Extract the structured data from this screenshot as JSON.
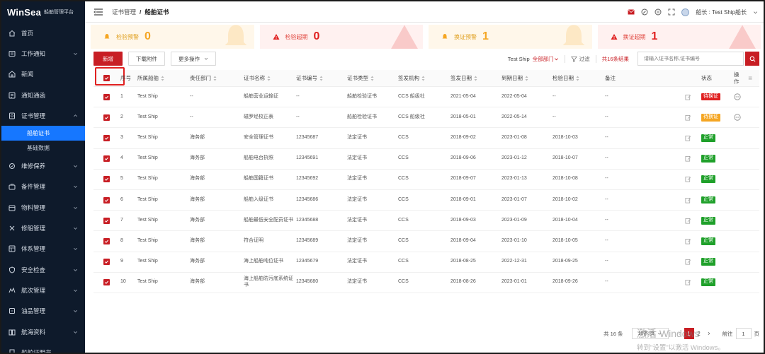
{
  "app": {
    "brand": "WinSea",
    "subtitle": "船舶管理平台"
  },
  "sidebar": {
    "items": [
      {
        "label": "首页",
        "icon": "home-icon"
      },
      {
        "label": "工作通知",
        "icon": "notice-icon"
      },
      {
        "label": "新闻",
        "icon": "news-icon"
      },
      {
        "label": "通知通函",
        "icon": "bulletin-icon"
      },
      {
        "label": "证书管理",
        "icon": "certificate-icon",
        "expanded": true
      }
    ],
    "sub_items": [
      {
        "label": "船舶证书",
        "active": true
      },
      {
        "label": "基础数据",
        "active": false
      }
    ],
    "items_after": [
      {
        "label": "维修保养"
      },
      {
        "label": "备件管理"
      },
      {
        "label": "物料管理"
      },
      {
        "label": "修船管理"
      },
      {
        "label": "体系管理"
      },
      {
        "label": "安全检查"
      },
      {
        "label": "航次管理"
      },
      {
        "label": "油品管理"
      },
      {
        "label": "航海资料"
      },
      {
        "label": "船舶证明书"
      }
    ]
  },
  "header": {
    "breadcrumb_parent": "证书管理",
    "breadcrumb_sep": "/",
    "breadcrumb_current": "船舶证书",
    "user": "船长 : Test Ship船长"
  },
  "stats": [
    {
      "label": "检验预警",
      "value": "0",
      "kind": "warn"
    },
    {
      "label": "检验超期",
      "value": "0",
      "kind": "alert"
    },
    {
      "label": "换证预警",
      "value": "1",
      "kind": "warn"
    },
    {
      "label": "换证超期",
      "value": "1",
      "kind": "alert"
    }
  ],
  "toolbar": {
    "add": "新增",
    "download": "下载附件",
    "more": "更多操作",
    "ship": "Test Ship",
    "dept": "全部部门",
    "filter": "过滤",
    "count": "共16条结果",
    "search_placeholder": "请输入证书名称,证书编号"
  },
  "table": {
    "headers": {
      "no": "序号",
      "ship": "所属船舶",
      "dept": "责任部门",
      "name": "证书名称",
      "code": "证书编号",
      "type": "证书类型",
      "org": "签发机构",
      "issue": "签发日期",
      "expire": "到期日期",
      "check": "检验日期",
      "note": "备注",
      "status": "状态",
      "op": "操作"
    },
    "rows": [
      {
        "no": "1",
        "ship": "Test Ship",
        "dept": "--",
        "name": "船舶营业运输证",
        "code": "--",
        "type": "船舶检验证书",
        "org": "CCS 船级社",
        "issue": "2021-05-04",
        "expire": "2022-05-04",
        "check": "--",
        "note": "--",
        "status": "待换证",
        "status_color": "red",
        "has_more": true
      },
      {
        "no": "2",
        "ship": "Test Ship",
        "dept": "--",
        "name": "磁罗经校正表",
        "code": "--",
        "type": "船舶检验证书",
        "org": "CCS 船级社",
        "issue": "2018-05-01",
        "expire": "2022-05-14",
        "check": "--",
        "note": "--",
        "status": "待换证",
        "status_color": "orange",
        "has_more": true
      },
      {
        "no": "3",
        "ship": "Test Ship",
        "dept": "海务部",
        "name": "安全管理证书",
        "code": "12345687",
        "type": "法定证书",
        "org": "CCS",
        "issue": "2018-09-02",
        "expire": "2023-01-08",
        "check": "2018-10-03",
        "note": "--",
        "status": "正常",
        "status_color": "green",
        "has_more": false
      },
      {
        "no": "4",
        "ship": "Test Ship",
        "dept": "海务部",
        "name": "船舶电台执照",
        "code": "12345691",
        "type": "法定证书",
        "org": "CCS",
        "issue": "2018-09-06",
        "expire": "2023-01-12",
        "check": "2018-10-07",
        "note": "--",
        "status": "正常",
        "status_color": "green",
        "has_more": false
      },
      {
        "no": "5",
        "ship": "Test Ship",
        "dept": "海务部",
        "name": "船舶国籍证书",
        "code": "12345692",
        "type": "法定证书",
        "org": "CCS",
        "issue": "2018-09-07",
        "expire": "2023-01-13",
        "check": "2018-10-08",
        "note": "--",
        "status": "正常",
        "status_color": "green",
        "has_more": false
      },
      {
        "no": "6",
        "ship": "Test Ship",
        "dept": "海务部",
        "name": "船舶入级证书",
        "code": "12345686",
        "type": "法定证书",
        "org": "CCS",
        "issue": "2018-09-01",
        "expire": "2023-01-07",
        "check": "2018-10-02",
        "note": "--",
        "status": "正常",
        "status_color": "green",
        "has_more": false
      },
      {
        "no": "7",
        "ship": "Test Ship",
        "dept": "海务部",
        "name": "船舶最低安全配员证书",
        "code": "12345688",
        "type": "法定证书",
        "org": "CCS",
        "issue": "2018-09-03",
        "expire": "2023-01-09",
        "check": "2018-10-04",
        "note": "--",
        "status": "正常",
        "status_color": "green",
        "has_more": false
      },
      {
        "no": "8",
        "ship": "Test Ship",
        "dept": "海务部",
        "name": "符合证明",
        "code": "12345689",
        "type": "法定证书",
        "org": "CCS",
        "issue": "2018-09-04",
        "expire": "2023-01-10",
        "check": "2018-10-05",
        "note": "--",
        "status": "正常",
        "status_color": "green",
        "has_more": false
      },
      {
        "no": "9",
        "ship": "Test Ship",
        "dept": "海务部",
        "name": "海上船舶吨位证书",
        "code": "12345679",
        "type": "法定证书",
        "org": "CCS",
        "issue": "2018-08-25",
        "expire": "2022-12-31",
        "check": "2018-09-25",
        "note": "--",
        "status": "正常",
        "status_color": "green",
        "has_more": false
      },
      {
        "no": "10",
        "ship": "Test Ship",
        "dept": "海务部",
        "name": "海上船舶防污底系统证书",
        "code": "12345680",
        "type": "法定证书",
        "org": "CCS",
        "issue": "2018-08-26",
        "expire": "2023-01-01",
        "check": "2018-09-26",
        "note": "--",
        "status": "正常",
        "status_color": "green",
        "has_more": false
      }
    ]
  },
  "pagination": {
    "total": "共 16 条",
    "page_size": "10条/页",
    "current_page": "1",
    "next_page": "2",
    "goto_label": "前往",
    "goto_value": "1",
    "page_unit": "页"
  },
  "watermark": {
    "line1": "激活 Windows",
    "line2": "转到\"设置\"以激活 Windows。"
  },
  "colors": {
    "brand_red": "#c81e24",
    "sidebar_bg": "#0e1a2b",
    "active_blue": "#1677ff",
    "ok_green": "#1fa02a",
    "warn_orange": "#f5a623"
  }
}
